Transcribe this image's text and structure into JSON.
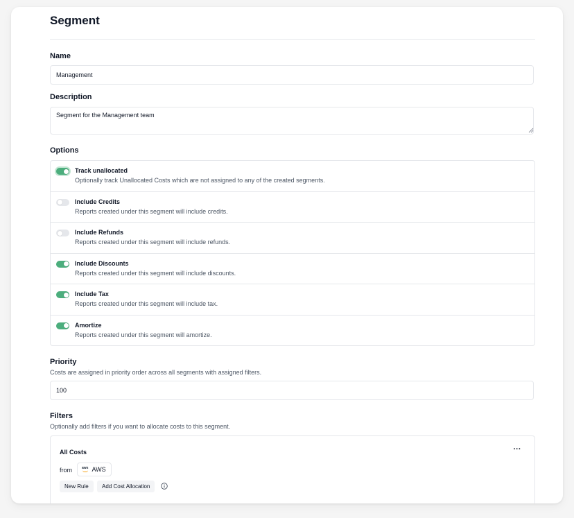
{
  "page": {
    "title": "Segment"
  },
  "name": {
    "label": "Name",
    "value": "Management"
  },
  "description": {
    "label": "Description",
    "value": "Segment for the Management team"
  },
  "options": {
    "label": "Options",
    "items": [
      {
        "title": "Track unallocated",
        "desc": "Optionally track Unallocated Costs which are not assigned to any of the created segments.",
        "enabled": true
      },
      {
        "title": "Include Credits",
        "desc": "Reports created under this segment will include credits.",
        "enabled": false
      },
      {
        "title": "Include Refunds",
        "desc": "Reports created under this segment will include refunds.",
        "enabled": false
      },
      {
        "title": "Include Discounts",
        "desc": "Reports created under this segment will include discounts.",
        "enabled": true
      },
      {
        "title": "Include Tax",
        "desc": "Reports created under this segment will include tax.",
        "enabled": true
      },
      {
        "title": "Amortize",
        "desc": "Reports created under this segment will amortize.",
        "enabled": true
      }
    ]
  },
  "priority": {
    "label": "Priority",
    "hint": "Costs are assigned in priority order across all segments with assigned filters.",
    "value": "100"
  },
  "filters": {
    "label": "Filters",
    "hint": "Optionally add filters if you want to allocate costs to this segment.",
    "group": {
      "title": "All Costs",
      "more_label": "···",
      "from_label": "from",
      "provider": {
        "logo_text": "aws",
        "label": "AWS"
      },
      "new_rule_label": "New Rule",
      "add_allocation_label": "Add Cost Allocation"
    }
  },
  "colors": {
    "toggle_on": "#4cae7d",
    "toggle_off": "#e5e7eb",
    "border": "#e5e7eb"
  }
}
